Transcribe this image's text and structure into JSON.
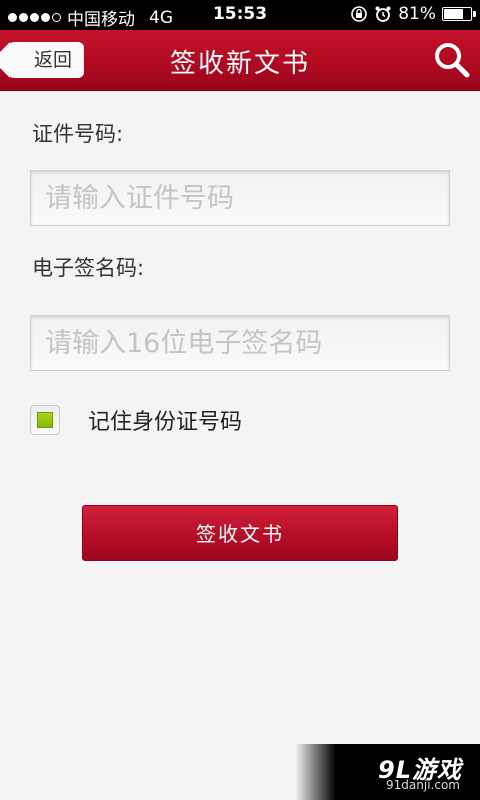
{
  "status_bar": {
    "carrier": "中国移动",
    "network": "4G",
    "time": "15:53",
    "battery": "81%",
    "battery_level": 0.81
  },
  "nav": {
    "back_label": "返回",
    "title": "签收新文书"
  },
  "form": {
    "id_label": "证件号码:",
    "id_placeholder": "请输入证件号码",
    "id_value": "",
    "code_label": "电子签名码:",
    "code_placeholder": "请输入16位电子签名码",
    "code_value": "",
    "remember_label": "记住身份证号码",
    "remember_checked": true,
    "submit_label": "签收文书"
  },
  "watermark": {
    "logo": "9L游戏",
    "url": "91danji.com"
  },
  "colors": {
    "nav_red": "#b10a22",
    "button_red": "#b40d26",
    "checkbox_green": "#94c612",
    "background": "#f4f4f4"
  }
}
